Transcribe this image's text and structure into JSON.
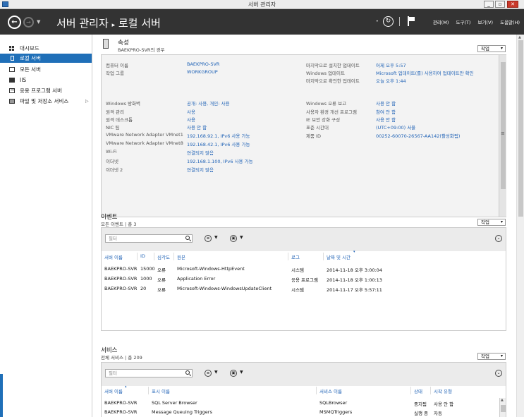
{
  "window": {
    "title": "서버 관리자",
    "controls": [
      "_",
      "▫",
      "✕"
    ]
  },
  "header": {
    "breadcrumb_root": "서버 관리자",
    "breadcrumb_sep": "▸",
    "breadcrumb_current": "로컬 서버",
    "menu": [
      "관리(M)",
      "도구(T)",
      "보기(V)",
      "도움말(H)"
    ]
  },
  "sidebar": {
    "items": [
      {
        "label": "대시보드",
        "icon": "dashboard-icon"
      },
      {
        "label": "로컬 서버",
        "icon": "server-icon"
      },
      {
        "label": "모든 서버",
        "icon": "servers-icon"
      },
      {
        "label": "IIS",
        "icon": "iis-icon"
      },
      {
        "label": "응용 프로그램 서버",
        "icon": "app-server-icon"
      },
      {
        "label": "파일 및 저장소 서비스",
        "icon": "file-storage-icon",
        "arrow": "▷"
      }
    ],
    "selected_index": 1
  },
  "properties": {
    "title": "속성",
    "subtitle": "BAEKPRO-SVR의 경우",
    "task_label": "작업",
    "left": [
      {
        "label": "컴퓨터 이름",
        "value": "BAEKPRO-SVR"
      },
      {
        "label": "작업 그룹",
        "value": "WORKGROUP"
      },
      {
        "label": "Windows 방화벽",
        "value": "공개: 사용, 개인: 사용"
      },
      {
        "label": "원격 관리",
        "value": "사용"
      },
      {
        "label": "원격 데스크톱",
        "value": "사용"
      },
      {
        "label": "NIC 팀",
        "value": "사용 안 함"
      },
      {
        "label": "VMware Network Adapter VMnet1",
        "value": "192.168.92.1, IPv6 사용 가능"
      },
      {
        "label": "VMware Network Adapter VMnet8",
        "value": "192.168.42.1, IPv6 사용 가능"
      },
      {
        "label": "Wi-Fi",
        "value": "연결되지 않음"
      },
      {
        "label": "이더넷",
        "value": "192.168.1.100, IPv6 사용 가능"
      },
      {
        "label": "이더넷 2",
        "value": "연결되지 않음"
      }
    ],
    "right": [
      {
        "label": "마지막으로 설치한 업데이트",
        "value": "어제 오후 5:57"
      },
      {
        "label": "Windows 업데이트",
        "value": "Microsoft 업데이트(를) 사용하여 업데이트만 확인"
      },
      {
        "label": "마지막으로 확인한 업데이트",
        "value": "오늘 오후 1:44"
      },
      {
        "label": "Windows 오류 보고",
        "value": "사용 안 함"
      },
      {
        "label": "사용자 환경 개선 프로그램",
        "value": "참여 안 함"
      },
      {
        "label": "IE 보안 강화 구성",
        "value": "사용 안 함"
      },
      {
        "label": "표준 시간대",
        "value": "(UTC+09:00) 서울"
      },
      {
        "label": "제품 ID",
        "value": "00252-60070-26567-AA142(활성화됨)"
      }
    ]
  },
  "events": {
    "title": "이벤트",
    "subtitle": "모든 이벤트 | 총 3",
    "task_label": "작업",
    "filter_placeholder": "필터",
    "columns": [
      "서버 이름",
      "ID",
      "심각도",
      "원본",
      "로그",
      "날짜 및 시간"
    ],
    "rows": [
      [
        "BAEKPRO-SVR",
        "15000",
        "오류",
        "Microsoft-Windows-HttpEvent",
        "시스템",
        "2014-11-18 오후 3:00:04"
      ],
      [
        "BAEKPRO-SVR",
        "1000",
        "오류",
        "Application Error",
        "응용 프로그램",
        "2014-11-18 오후 1:00:13"
      ],
      [
        "BAEKPRO-SVR",
        "20",
        "오류",
        "Microsoft-Windows-WindowsUpdateClient",
        "시스템",
        "2014-11-17 오후 5:57:11"
      ]
    ]
  },
  "services": {
    "title": "서비스",
    "subtitle": "전체 서비스 | 총 209",
    "task_label": "작업",
    "filter_placeholder": "필터",
    "columns": [
      "서버 이름",
      "표시 이름",
      "서비스 이름",
      "상태",
      "시작 유형"
    ],
    "rows": [
      [
        "BAEKPRO-SVR",
        "SQL Server Browser",
        "SQLBrowser",
        "중지됨",
        "사용 안 함"
      ],
      [
        "BAEKPRO-SVR",
        "Message Queuing Triggers",
        "MSMQTriggers",
        "실행 중",
        "자동"
      ]
    ]
  },
  "colors": {
    "header_bg": "#333333",
    "accent": "#1f6fb8",
    "link": "#1f62b6"
  }
}
